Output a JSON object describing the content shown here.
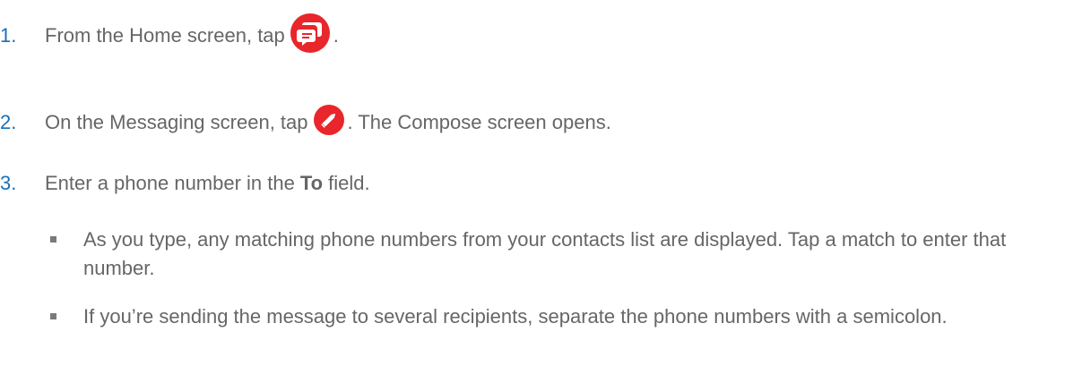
{
  "steps": [
    {
      "number": "1.",
      "before": "From the Home screen, tap",
      "icon": "messaging-app-icon",
      "after": "."
    },
    {
      "number": "2.",
      "before": "On the Messaging screen, tap",
      "icon": "compose-pencil-icon",
      "after": ". The Compose screen opens."
    },
    {
      "number": "3.",
      "before": "Enter a phone number in the",
      "bold": "To",
      "after": "field."
    }
  ],
  "bullets": [
    "As you type, any matching phone numbers from your contacts list are displayed. Tap a match to enter that number.",
    "If you’re sending the message to several recipients, separate the phone numbers with a semicolon."
  ],
  "colors": {
    "number": "#1a6fb5",
    "text": "#666666",
    "icon_red": "#e8262b"
  }
}
